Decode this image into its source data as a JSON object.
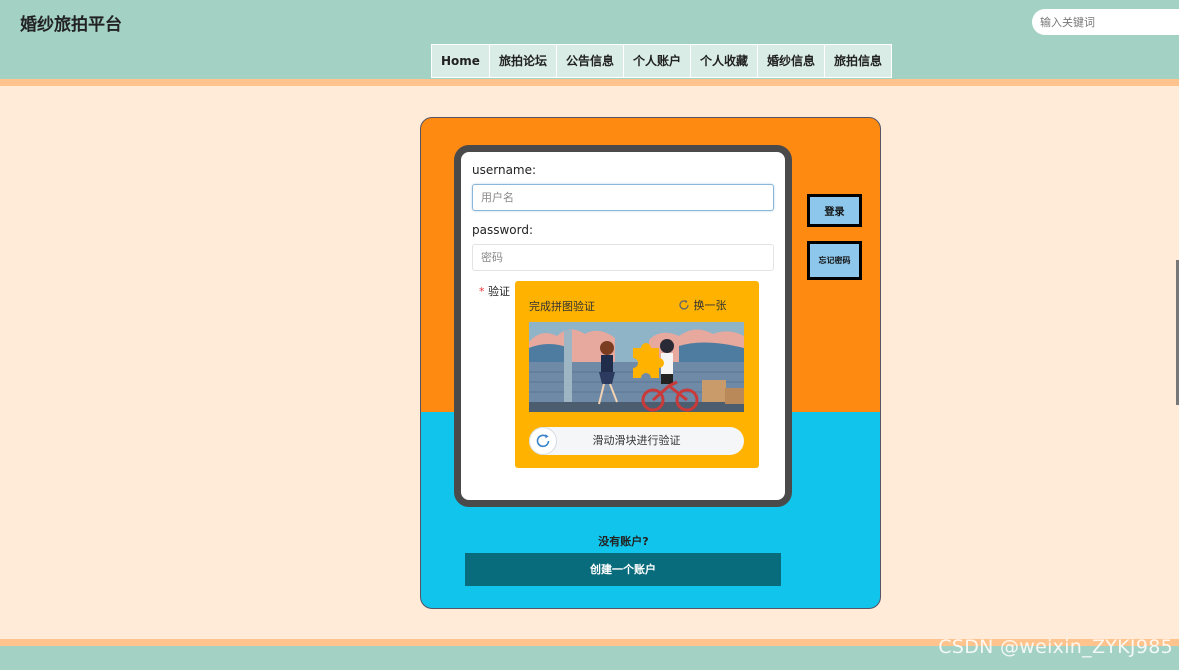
{
  "header": {
    "site_title": "婚纱旅拍平台",
    "search_placeholder": "输入关键词",
    "nav": [
      {
        "label": "Home"
      },
      {
        "label": "旅拍论坛"
      },
      {
        "label": "公告信息"
      },
      {
        "label": "个人账户"
      },
      {
        "label": "个人收藏"
      },
      {
        "label": "婚纱信息"
      },
      {
        "label": "旅拍信息"
      }
    ]
  },
  "login": {
    "username_label": "username:",
    "username_placeholder": "用户名",
    "username_value": "",
    "password_label": "password:",
    "password_placeholder": "密码",
    "verify_required_mark": "*",
    "verify_label": "验证",
    "captcha": {
      "title": "完成拼图验证",
      "refresh_label": "换一张",
      "slider_text": "滑动滑块进行验证"
    },
    "login_button": "登录",
    "forgot_button": "忘记密码",
    "no_account_text": "没有账户?",
    "create_account_button": "创建一个账户"
  },
  "colors": {
    "header_bg": "#a3d1c4",
    "stripe": "#ffc48e",
    "page_bg": "#ffebd8",
    "panel_top": "#fe8a12",
    "panel_bottom": "#10c4eb",
    "captcha_bg": "#ffb300",
    "side_button_bg": "#8ec7ec",
    "create_button_bg": "#096c7c"
  },
  "watermark": "CSDN @weixin_ZYKJ985"
}
